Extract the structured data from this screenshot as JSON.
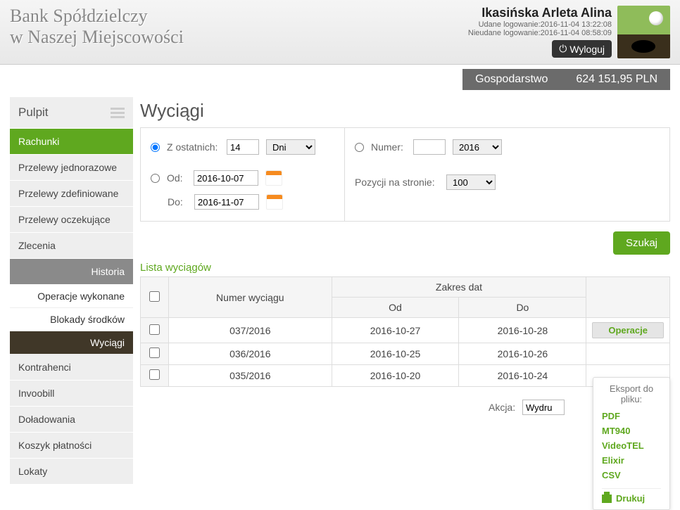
{
  "header": {
    "bank_line1": "Bank Spółdzielczy",
    "bank_line2": "w Naszej Miejscowości",
    "user_name": "Ikasińska Arleta Alina",
    "login_ok": "Udane logowanie:2016-11-04 13:22:08",
    "login_fail": "Nieudane logowanie:2016-11-04 08:58:09",
    "logout": "Wyloguj"
  },
  "account": {
    "name": "Gospodarstwo",
    "balance": "624 151,95 PLN"
  },
  "sidebar": {
    "pulpit": "Pulpit",
    "items": [
      "Rachunki",
      "Przelewy jednorazowe",
      "Przelewy zdefiniowane",
      "Przelewy oczekujące",
      "Zlecenia"
    ],
    "historia": "Historia",
    "subs": [
      "Operacje wykonane",
      "Blokady środków",
      "Wyciągi"
    ],
    "rest": [
      "Kontrahenci",
      "Invoobill",
      "Doładowania",
      "Koszyk płatności",
      "Lokaty"
    ]
  },
  "page": {
    "title": "Wyciągi"
  },
  "filter": {
    "z_ostatnich": "Z ostatnich:",
    "z_val": "14",
    "z_unit": "Dni",
    "od": "Od:",
    "od_val": "2016-10-07",
    "do": "Do:",
    "do_val": "2016-11-07",
    "numer": "Numer:",
    "numer_val": "",
    "numer_year": "2016",
    "poz": "Pozycji na stronie:",
    "poz_val": "100",
    "szukaj": "Szukaj"
  },
  "list_title": "Lista wyciągów",
  "table": {
    "h_numer": "Numer wyciągu",
    "h_zakres": "Zakres dat",
    "h_od": "Od",
    "h_do": "Do",
    "rows": [
      {
        "nr": "037/2016",
        "od": "2016-10-27",
        "do": "2016-10-28"
      },
      {
        "nr": "036/2016",
        "od": "2016-10-25",
        "do": "2016-10-26"
      },
      {
        "nr": "035/2016",
        "od": "2016-10-20",
        "do": "2016-10-24"
      }
    ],
    "operacje": "Operacje"
  },
  "akcja": {
    "label": "Akcja:",
    "value": "Wydru"
  },
  "menu": {
    "hdr": "Eksport do pliku:",
    "items": [
      "PDF",
      "MT940",
      "VideoTEL",
      "Elixir",
      "CSV"
    ],
    "drukuj": "Drukuj"
  }
}
